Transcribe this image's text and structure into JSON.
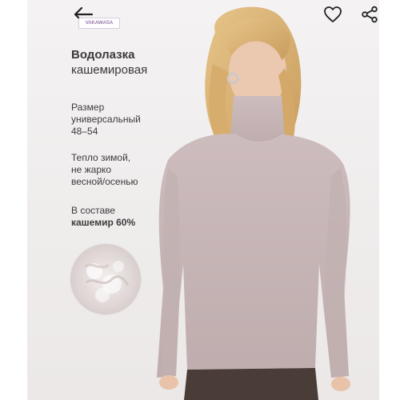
{
  "brand": {
    "label": "VAKAWASA"
  },
  "product": {
    "title": "Водолазка",
    "subtitle": "кашемировая"
  },
  "features": {
    "size": {
      "line1": "Размер",
      "line2": "универсальный",
      "line3": "48–54"
    },
    "season": {
      "line1": "Тепло зимой,",
      "line2": "не жарко",
      "line3": "весной/осенью"
    },
    "composition": {
      "line1": "В составе",
      "line2": "кашемир 60%"
    }
  },
  "icons": {
    "back": "arrow-left-icon",
    "favorite": "heart-icon",
    "share": "share-icon"
  },
  "colors": {
    "sweater": "#c9b8b9",
    "hair": "#d9b277",
    "skin": "#e9c6ae",
    "pants": "#4a3c36",
    "text": "#3a3a3a",
    "brand": "#6a3d8c"
  }
}
